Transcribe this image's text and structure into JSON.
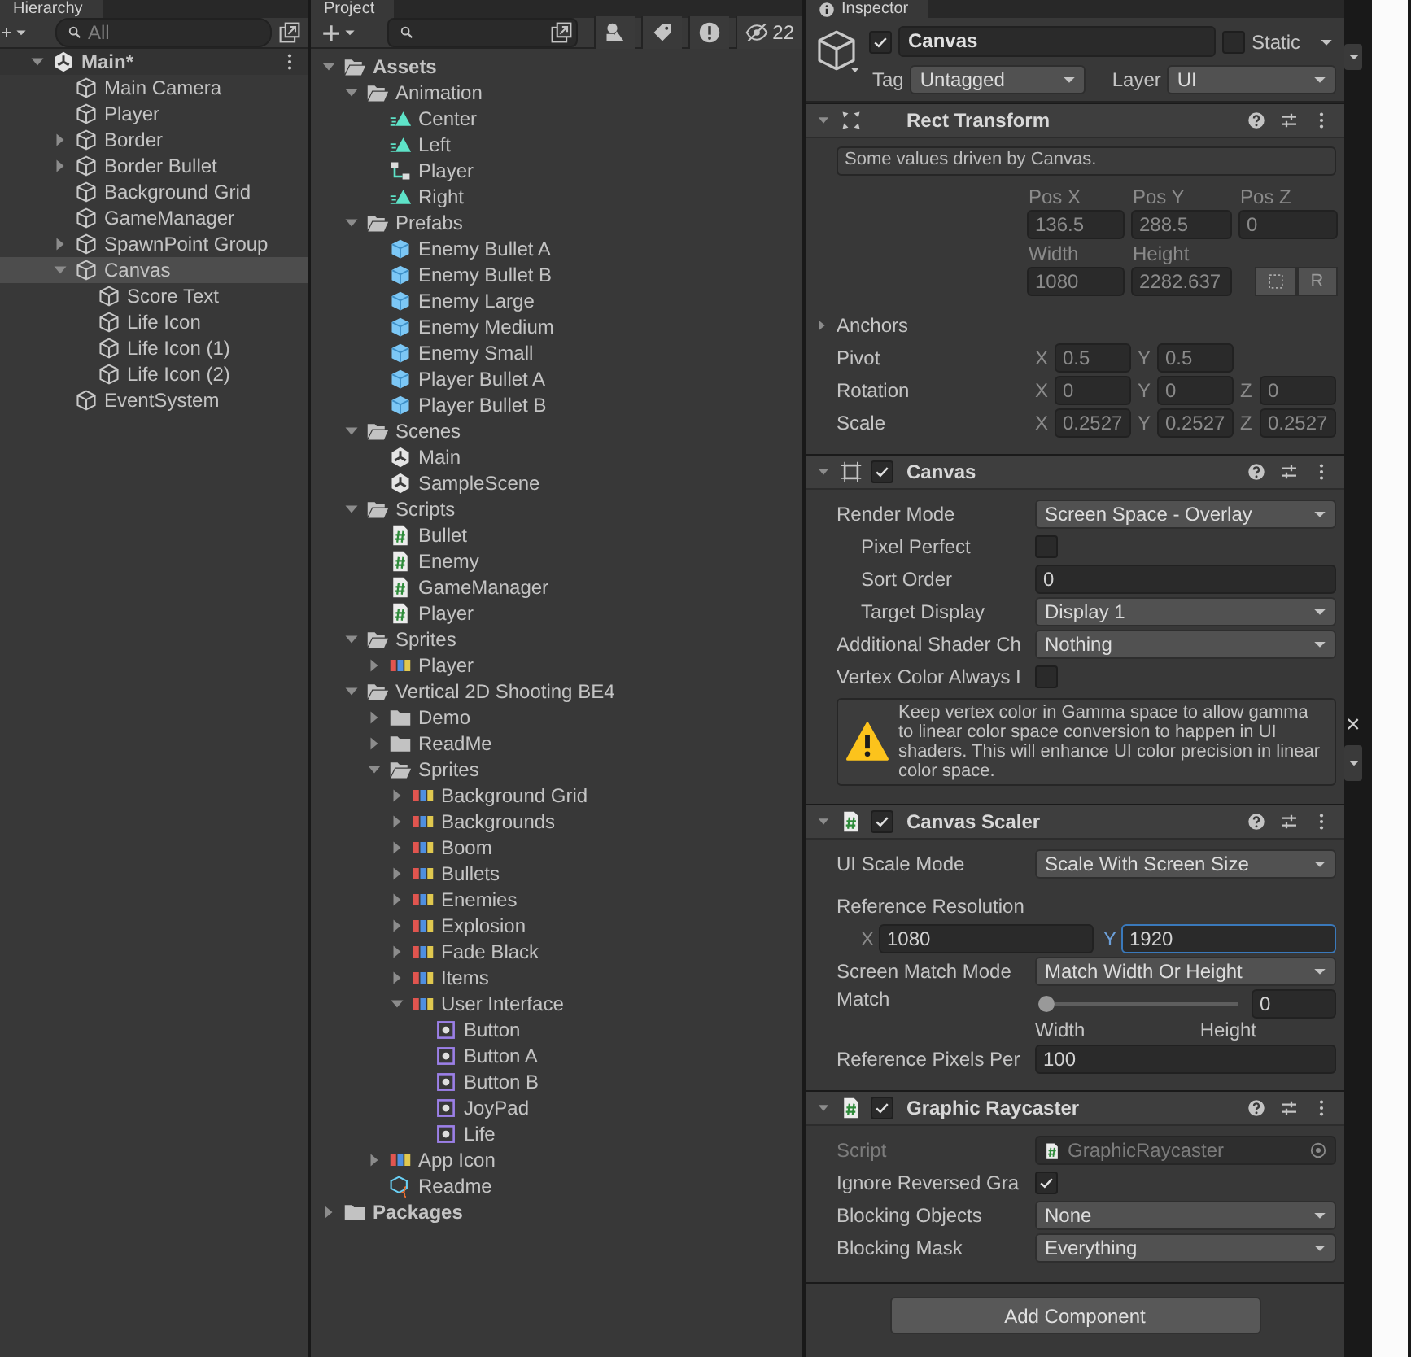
{
  "hierarchy": {
    "title": "Hierarchy",
    "search": {
      "placeholder": "All"
    },
    "items": [
      {
        "label": "Main*",
        "kind": "scene",
        "expanded": true,
        "selected": false,
        "children": [
          {
            "label": "Main Camera",
            "kind": "gameobject",
            "selected": false
          },
          {
            "label": "Player",
            "kind": "gameobject",
            "selected": false
          },
          {
            "label": "Border",
            "kind": "gameobject",
            "expanded": false,
            "selected": false
          },
          {
            "label": "Border Bullet",
            "kind": "gameobject",
            "expanded": false,
            "selected": false
          },
          {
            "label": "Background Grid",
            "kind": "gameobject",
            "selected": false
          },
          {
            "label": "GameManager",
            "kind": "gameobject",
            "selected": false
          },
          {
            "label": "SpawnPoint Group",
            "kind": "gameobject",
            "expanded": false,
            "selected": false
          },
          {
            "label": "Canvas",
            "kind": "gameobject",
            "expanded": true,
            "selected": true,
            "children": [
              {
                "label": "Score Text",
                "kind": "gameobject",
                "selected": false
              },
              {
                "label": "Life Icon",
                "kind": "gameobject",
                "selected": false
              },
              {
                "label": "Life Icon (1)",
                "kind": "gameobject",
                "selected": false
              },
              {
                "label": "Life Icon (2)",
                "kind": "gameobject",
                "selected": false
              }
            ]
          },
          {
            "label": "EventSystem",
            "kind": "gameobject",
            "selected": false
          }
        ]
      }
    ]
  },
  "project": {
    "title": "Project",
    "hidden_count": "22",
    "items": [
      {
        "label": "Assets",
        "kind": "folder",
        "expanded": true,
        "selected": false,
        "children": [
          {
            "label": "Animation",
            "kind": "folder",
            "expanded": true,
            "selected": false,
            "children": [
              {
                "label": "Center",
                "kind": "animation",
                "selected": false
              },
              {
                "label": "Left",
                "kind": "animation",
                "selected": false
              },
              {
                "label": "Player",
                "kind": "animator",
                "selected": false
              },
              {
                "label": "Right",
                "kind": "animation",
                "selected": false
              }
            ]
          },
          {
            "label": "Prefabs",
            "kind": "folder",
            "expanded": true,
            "selected": false,
            "children": [
              {
                "label": "Enemy Bullet A",
                "kind": "prefab",
                "selected": false
              },
              {
                "label": "Enemy Bullet B",
                "kind": "prefab",
                "selected": false
              },
              {
                "label": "Enemy Large",
                "kind": "prefab",
                "selected": false
              },
              {
                "label": "Enemy Medium",
                "kind": "prefab",
                "selected": false
              },
              {
                "label": "Enemy Small",
                "kind": "prefab",
                "selected": false
              },
              {
                "label": "Player Bullet A",
                "kind": "prefab",
                "selected": false
              },
              {
                "label": "Player Bullet B",
                "kind": "prefab",
                "selected": false
              }
            ]
          },
          {
            "label": "Scenes",
            "kind": "folder",
            "expanded": true,
            "selected": false,
            "children": [
              {
                "label": "Main",
                "kind": "scene",
                "selected": false
              },
              {
                "label": "SampleScene",
                "kind": "scene",
                "selected": false
              }
            ]
          },
          {
            "label": "Scripts",
            "kind": "folder",
            "expanded": true,
            "selected": false,
            "children": [
              {
                "label": "Bullet",
                "kind": "script",
                "selected": false
              },
              {
                "label": "Enemy",
                "kind": "script",
                "selected": false
              },
              {
                "label": "GameManager",
                "kind": "script",
                "selected": false
              },
              {
                "label": "Player",
                "kind": "script",
                "selected": false
              }
            ]
          },
          {
            "label": "Sprites",
            "kind": "folder",
            "expanded": true,
            "selected": false,
            "children": [
              {
                "label": "Player",
                "kind": "sprite",
                "expanded": false,
                "selected": false
              }
            ]
          },
          {
            "label": "Vertical 2D Shooting BE4",
            "kind": "folder",
            "expanded": true,
            "selected": false,
            "children": [
              {
                "label": "Demo",
                "kind": "folder",
                "expanded": false,
                "selected": false
              },
              {
                "label": "ReadMe",
                "kind": "folder",
                "expanded": false,
                "selected": false
              },
              {
                "label": "Sprites",
                "kind": "folder",
                "expanded": true,
                "selected": false,
                "children": [
                  {
                    "label": "Background Grid",
                    "kind": "sprite",
                    "expanded": false,
                    "selected": false
                  },
                  {
                    "label": "Backgrounds",
                    "kind": "sprite",
                    "expanded": false,
                    "selected": false
                  },
                  {
                    "label": "Boom",
                    "kind": "sprite",
                    "expanded": false,
                    "selected": false
                  },
                  {
                    "label": "Bullets",
                    "kind": "sprite",
                    "expanded": false,
                    "selected": false
                  },
                  {
                    "label": "Enemies",
                    "kind": "sprite",
                    "expanded": false,
                    "selected": false
                  },
                  {
                    "label": "Explosion",
                    "kind": "sprite",
                    "expanded": false,
                    "selected": false
                  },
                  {
                    "label": "Fade Black",
                    "kind": "sprite",
                    "expanded": false,
                    "selected": false
                  },
                  {
                    "label": "Items",
                    "kind": "sprite",
                    "expanded": false,
                    "selected": false
                  },
                  {
                    "label": "User Interface",
                    "kind": "sprite",
                    "expanded": true,
                    "selected": false,
                    "children": [
                      {
                        "label": "Button",
                        "kind": "ui_sprite",
                        "selected": false
                      },
                      {
                        "label": "Button A",
                        "kind": "ui_sprite",
                        "selected": false
                      },
                      {
                        "label": "Button B",
                        "kind": "ui_sprite",
                        "selected": false
                      },
                      {
                        "label": "JoyPad",
                        "kind": "ui_sprite",
                        "selected": false
                      },
                      {
                        "label": "Life",
                        "kind": "ui_sprite",
                        "selected": false
                      }
                    ]
                  }
                ]
              },
              {
                "label": "App Icon",
                "kind": "sprite",
                "expanded": false,
                "selected": false
              },
              {
                "label": "Readme",
                "kind": "readme",
                "selected": false
              }
            ]
          }
        ]
      },
      {
        "label": "Packages",
        "kind": "folder",
        "expanded": false,
        "selected": false
      }
    ]
  },
  "inspector": {
    "title": "Inspector",
    "object": {
      "active": true,
      "name": "Canvas",
      "static": false,
      "static_label": "Static",
      "tag_label": "Tag",
      "tag": "Untagged",
      "layer_label": "Layer",
      "layer": "UI"
    },
    "components": [
      {
        "kind": "rect_transform",
        "title": "Rect Transform",
        "expanded": true,
        "rows": [
          {
            "kind": "info",
            "text": "Some values driven by Canvas."
          },
          {
            "kind": "rect_fields",
            "cells": [
              {
                "label": "Pos X",
                "value": "136.5"
              },
              {
                "label": "Pos Y",
                "value": "288.5"
              },
              {
                "label": "Pos Z",
                "value": "0"
              },
              {
                "label": "Width",
                "value": "1080"
              },
              {
                "label": "Height",
                "value": "2282.637"
              }
            ],
            "raw_button": "R"
          },
          {
            "kind": "foldout",
            "label": "Anchors",
            "expanded": false
          },
          {
            "kind": "vector",
            "label": "Pivot",
            "axes": [
              {
                "axis": "X",
                "value": "0.5"
              },
              {
                "axis": "Y",
                "value": "0.5"
              }
            ]
          },
          {
            "kind": "vector",
            "label": "Rotation",
            "axes": [
              {
                "axis": "X",
                "value": "0"
              },
              {
                "axis": "Y",
                "value": "0"
              },
              {
                "axis": "Z",
                "value": "0"
              }
            ]
          },
          {
            "kind": "vector",
            "label": "Scale",
            "axes": [
              {
                "axis": "X",
                "value": "0.2527"
              },
              {
                "axis": "Y",
                "value": "0.2527"
              },
              {
                "axis": "Z",
                "value": "0.2527"
              }
            ]
          }
        ]
      },
      {
        "kind": "canvas",
        "title": "Canvas",
        "enabled": true,
        "expanded": true,
        "rows": [
          {
            "kind": "dropdown",
            "label": "Render Mode",
            "value": "Screen Space - Overlay",
            "indented": false
          },
          {
            "kind": "checkbox",
            "label": "Pixel Perfect",
            "checked": false,
            "indented": true
          },
          {
            "kind": "number",
            "label": "Sort Order",
            "value": "0",
            "indented": true
          },
          {
            "kind": "dropdown",
            "label": "Target Display",
            "value": "Display 1",
            "indented": true
          },
          {
            "kind": "dropdown",
            "label": "Additional Shader Ch",
            "value": "Nothing",
            "indented": false
          },
          {
            "kind": "checkbox",
            "label": "Vertex Color Always I",
            "checked": false,
            "indented": false
          },
          {
            "kind": "warning",
            "text": "Keep vertex color in Gamma space to allow gamma to linear color space conversion to happen in UI shaders. This will enhance UI color precision in linear color space."
          }
        ]
      },
      {
        "kind": "script",
        "title": "Canvas Scaler",
        "enabled": true,
        "expanded": true,
        "rows": [
          {
            "kind": "dropdown",
            "label": "UI Scale Mode",
            "value": "Scale With Screen Size",
            "indented": false
          },
          {
            "kind": "heading",
            "label": "Reference Resolution"
          },
          {
            "kind": "vector_wide",
            "axes": [
              {
                "axis": "X",
                "value": "1080",
                "focused": false
              },
              {
                "axis": "Y",
                "value": "1920",
                "focused": true
              }
            ]
          },
          {
            "kind": "dropdown",
            "label": "Screen Match Mode",
            "value": "Match Width Or Height",
            "indented": false
          },
          {
            "kind": "slider",
            "label": "Match",
            "level": 0,
            "value": "0",
            "min_label": "Width",
            "max_label": "Height"
          },
          {
            "kind": "number",
            "label": "Reference Pixels Per",
            "value": "100",
            "indented": false
          }
        ]
      },
      {
        "kind": "script",
        "title": "Graphic Raycaster",
        "enabled": true,
        "expanded": true,
        "rows": [
          {
            "kind": "object",
            "label": "Script",
            "value": "GraphicRaycaster",
            "disabled": true
          },
          {
            "kind": "checkbox",
            "label": "Ignore Reversed Gra",
            "checked": true,
            "indented": false
          },
          {
            "kind": "dropdown",
            "label": "Blocking Objects",
            "value": "None",
            "indented": false
          },
          {
            "kind": "dropdown",
            "label": "Blocking Mask",
            "value": "Everything",
            "indented": false
          }
        ]
      }
    ],
    "add_button": "Add Component"
  },
  "side": {
    "close_glyph": "×"
  }
}
